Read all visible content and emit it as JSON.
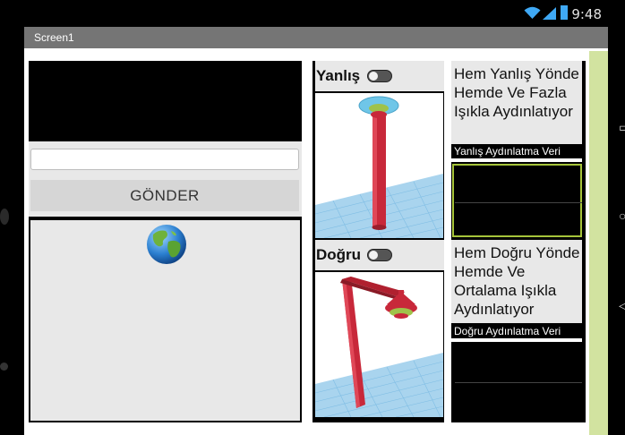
{
  "status_bar": {
    "time": "9:48",
    "wifi_icon": "wifi-icon",
    "signal_icon": "signal-icon",
    "battery_icon": "battery-icon"
  },
  "title_bar": {
    "title": "Screen1"
  },
  "form": {
    "input_value": "",
    "input_placeholder": "",
    "send_label": "GÖNDER"
  },
  "globe": {
    "icon": "globe-icon"
  },
  "wrong": {
    "switch_label": "Yanlış",
    "switch_on": false,
    "description": "Hem Yanlış Yönde Hemde Ve Fazla Işıkla Aydınlatıyor",
    "caption": "Yanlış Aydınlatma Veri"
  },
  "right": {
    "switch_label": "Doğru",
    "switch_on": false,
    "description": "Hem Doğru Yönde Hemde Ve Ortalama Işıkla Aydınlatıyor",
    "caption": "Doğru Aydınlatma Veri"
  },
  "colors": {
    "title_bar": "#757575",
    "accent_green": "#a6c43a",
    "side_strip": "#d2e3a0",
    "lamp_red": "#c8283a"
  }
}
